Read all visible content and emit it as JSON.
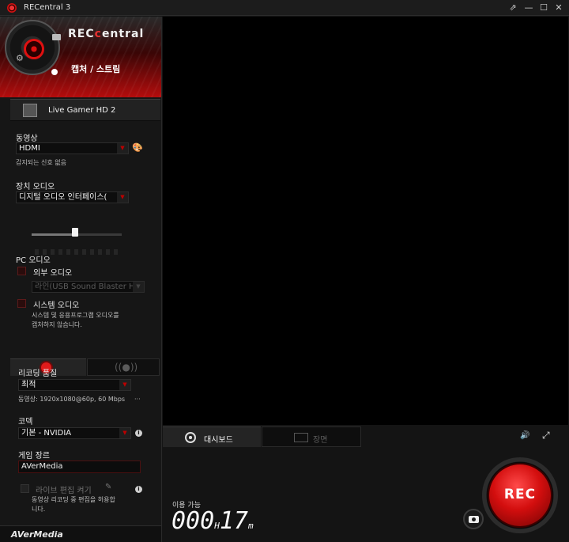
{
  "window": {
    "title": "RECentral 3",
    "controls": [
      "⇗",
      "—",
      "☐",
      "✕"
    ]
  },
  "brand": {
    "prefix": "REC",
    "suffix": "entral",
    "c": "c"
  },
  "hero": {
    "mode_label": "캡처 / 스트림"
  },
  "device": {
    "name": "Live Gamer HD 2"
  },
  "video": {
    "label": "동영상",
    "source": "HDMI",
    "status": "감지되는 신호 없음"
  },
  "device_audio": {
    "label": "장치 오디오",
    "source": "디지털 오디오 인터페이스(",
    "volume_fraction": 0.48
  },
  "pc_audio": {
    "label": "PC 오디오",
    "external": {
      "label": "외부 오디오",
      "source": "라인(USB Sound Blaster HI"
    },
    "system": {
      "label": "시스템 오디오",
      "note_line1": "시스템 및 응용프로그램 오디오를",
      "note_line2": "캡처하지 않습니다."
    }
  },
  "recording": {
    "quality_label": "리코딩 품질",
    "quality_value": "최적",
    "quality_detail": "동영상: 1920x1080@60p, 60 Mbps",
    "quality_more": "···",
    "codec_label": "코덱",
    "codec_value": "기본 - NVIDIA",
    "genre_label": "게임 장르",
    "genre_value": "AVerMedia",
    "live_edit_label": "라이브 편집 켜기",
    "live_edit_note_line1": "동영상 리코딩 중 편집을 허용합",
    "live_edit_note_line2": "니다."
  },
  "footer": {
    "logo": "AVerMedia"
  },
  "bottom": {
    "tab_dashboard": "대시보드",
    "tab_scene": "장면",
    "available_label": "이용 가능",
    "time_hours": "000",
    "time_h_unit": "H",
    "time_minutes": "17",
    "time_m_unit": "m",
    "rec_label": "REC"
  },
  "colors": {
    "accent": "#e01010",
    "background": "#151515",
    "preview": "#000000"
  },
  "icons": [
    "gear-icon",
    "folder-icon",
    "capture-icon",
    "palette-icon",
    "info-icon",
    "pen-icon",
    "record-icon",
    "stream-icon",
    "dashboard-icon",
    "scene-icon",
    "volume-icon",
    "fullscreen-icon",
    "camera-icon"
  ]
}
